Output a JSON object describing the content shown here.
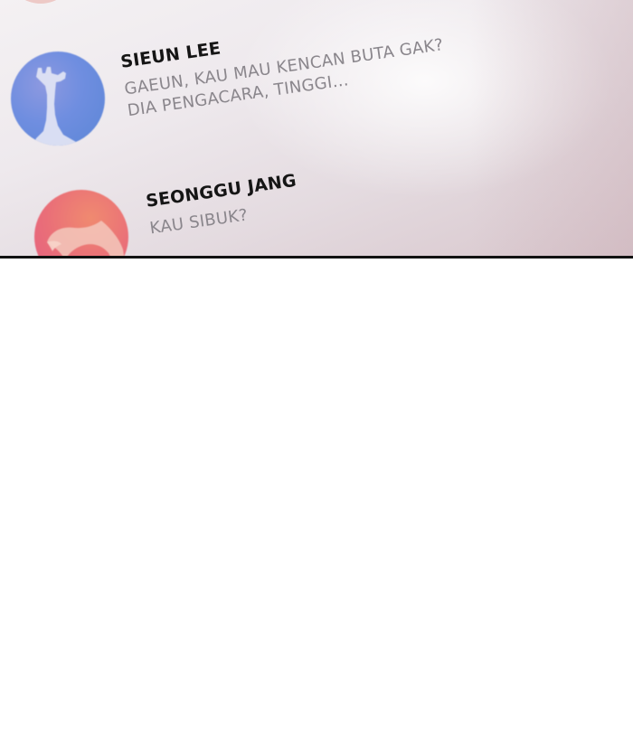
{
  "conversations": [
    {
      "name": "SIEUN LEE",
      "message_line_1": "GAEUN, KAU MAU KENCAN BUTA GAK?",
      "message_line_2": "DIA PENGACARA, TINGGI...",
      "avatar_icon": "giraffe-icon",
      "avatar_color": "#6f8ee0"
    },
    {
      "name": "SEONGGU JANG",
      "message_line_1": "KAU SIBUK?",
      "avatar_icon": "eagle-icon",
      "avatar_color": "#ea6f78"
    }
  ],
  "colors": {
    "panel_background": "#eee9ed",
    "name_text": "#151515",
    "message_text": "#8a868c",
    "panel_border": "#111111",
    "page_background": "#ffffff"
  }
}
